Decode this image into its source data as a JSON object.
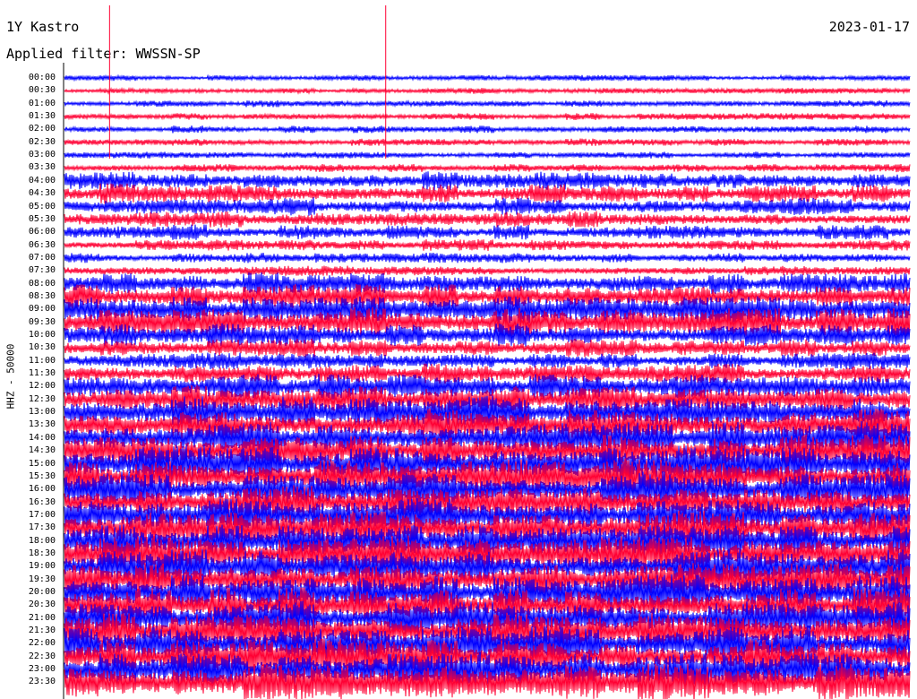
{
  "header": {
    "station": "1Y Kastro",
    "date": "2023-01-17",
    "filter": "Applied filter: WWSSN-SP"
  },
  "chart_data": {
    "type": "line",
    "title": "1Y Kastro",
    "date": "2023-01-17",
    "filter": "WWSSN-SP",
    "ylabel": "HHZ - 50000",
    "row_labels": [
      "00:00",
      "00:30",
      "01:00",
      "01:30",
      "02:00",
      "02:30",
      "03:00",
      "03:30",
      "04:00",
      "04:30",
      "05:00",
      "05:30",
      "06:00",
      "06:30",
      "07:00",
      "07:30",
      "08:00",
      "08:30",
      "09:00",
      "09:30",
      "10:00",
      "10:30",
      "11:00",
      "11:30",
      "12:00",
      "12:30",
      "13:00",
      "13:30",
      "14:00",
      "14:30",
      "15:00",
      "15:30",
      "16:00",
      "16:30",
      "17:00",
      "17:30",
      "18:00",
      "18:30",
      "19:00",
      "19:30",
      "20:00",
      "20:30",
      "21:00",
      "21:30",
      "22:00",
      "22:30",
      "23:00",
      "23:30"
    ],
    "trace_colors": [
      "#0000ff",
      "#ff0033"
    ],
    "relative_amplitude": [
      0.35,
      0.35,
      0.4,
      0.4,
      0.45,
      0.45,
      0.4,
      0.5,
      1.1,
      1.2,
      1.1,
      1.0,
      0.9,
      0.7,
      0.6,
      0.6,
      1.3,
      1.5,
      1.6,
      1.8,
      1.4,
      1.1,
      1.0,
      1.2,
      1.5,
      1.8,
      2.0,
      2.0,
      2.0,
      2.0,
      2.1,
      2.1,
      2.1,
      2.0,
      2.1,
      2.1,
      2.1,
      2.1,
      2.1,
      2.1,
      2.1,
      2.1,
      2.1,
      2.1,
      2.1,
      2.1,
      2.1,
      2.3
    ],
    "spike_events": [
      {
        "time_label": "00:00",
        "minute": 1.6
      },
      {
        "time_label": "00:00",
        "minute": 11.4
      }
    ]
  }
}
